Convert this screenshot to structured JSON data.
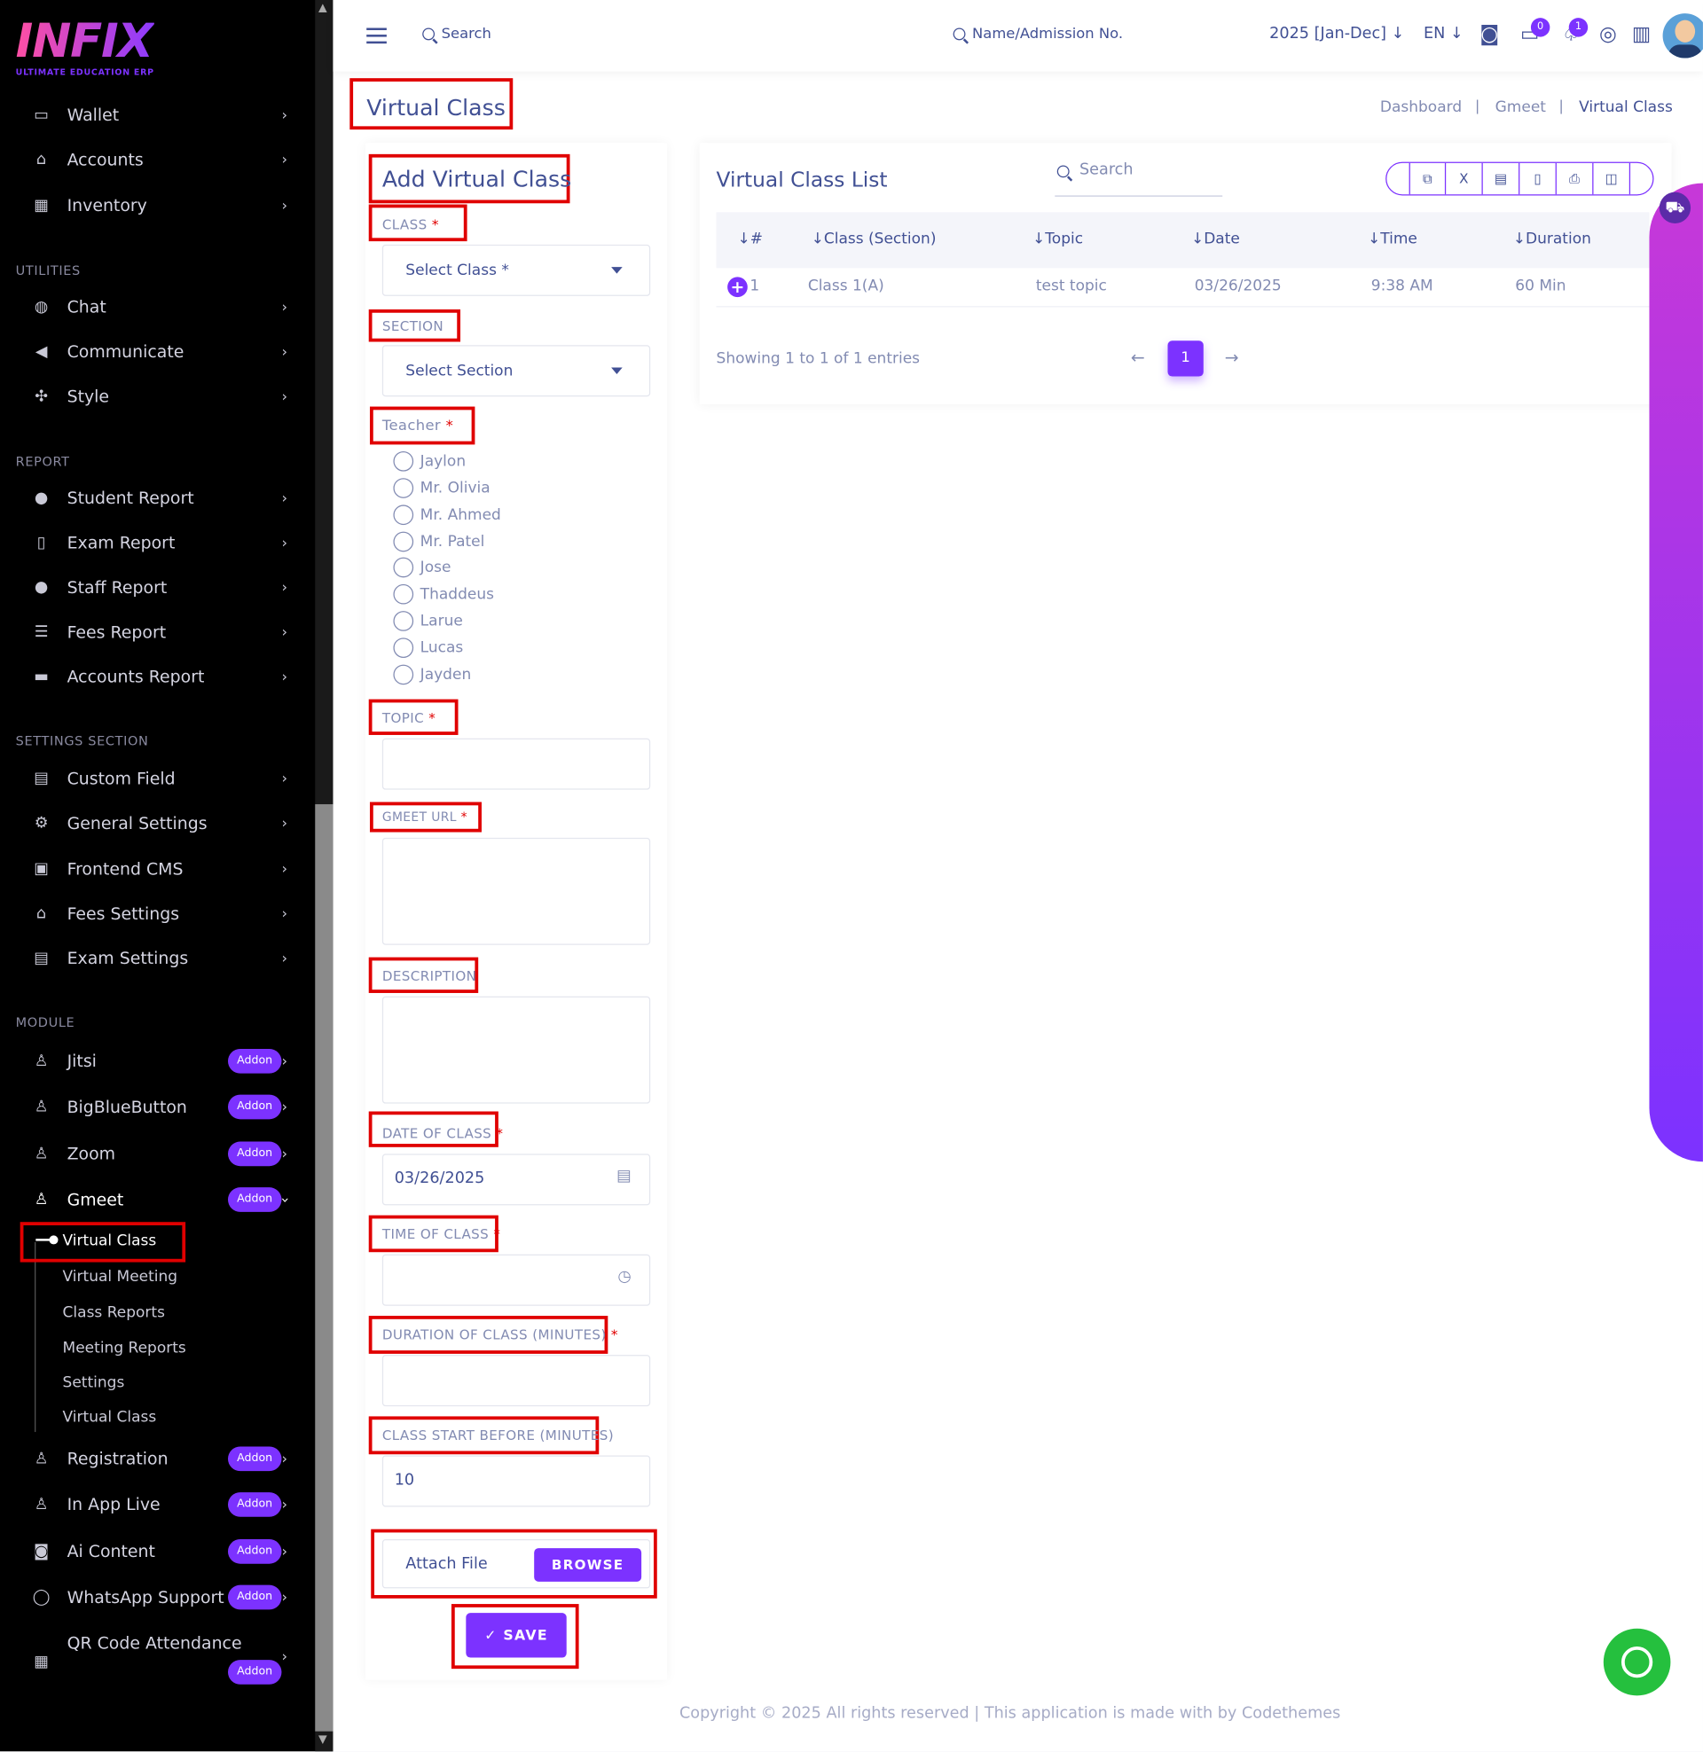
{
  "sidebar": {
    "logo": "INFIX",
    "logo_subtitle": "ULTIMATE EDUCATION ERP",
    "sections": {
      "utilities": "UTILITIES",
      "report": "REPORT",
      "settings": "SETTINGS SECTION",
      "module": "MODULE"
    },
    "items": {
      "wallet": "Wallet",
      "accounts": "Accounts",
      "inventory": "Inventory",
      "chat": "Chat",
      "communicate": "Communicate",
      "style": "Style",
      "student_report": "Student Report",
      "exam_report": "Exam Report",
      "staff_report": "Staff Report",
      "fees_report": "Fees Report",
      "accounts_report": "Accounts Report",
      "custom_field": "Custom Field",
      "general_settings": "General Settings",
      "frontend_cms": "Frontend CMS",
      "fees_settings": "Fees Settings",
      "exam_settings": "Exam Settings",
      "jitsi": "Jitsi",
      "bigbluebutton": "BigBlueButton",
      "zoom": "Zoom",
      "gmeet": "Gmeet",
      "registration": "Registration",
      "in_app_live": "In App Live",
      "ai_content": "Ai Content",
      "whatsapp_support": "WhatsApp Support",
      "qr_code_attendance": "QR Code Attendance"
    },
    "addon_label": "Addon",
    "gmeet_submenu": {
      "virtual_class": "Virtual Class",
      "virtual_meeting": "Virtual Meeting",
      "class_reports": "Class Reports",
      "meeting_reports": "Meeting Reports",
      "settings": "Settings",
      "virtual_class_2": "Virtual Class"
    }
  },
  "header": {
    "search": "Search",
    "student_search": "Name/Admission No.",
    "year": "2025 [Jan-Dec]",
    "language": "EN",
    "chat_badge": "0",
    "notification_badge": "1",
    "icons": [
      "menu-icon",
      "search-icon",
      "chevron-down-icon",
      "robot-icon",
      "chat-bubble-icon",
      "bell-icon",
      "globe-icon",
      "chart-icon",
      "avatar"
    ]
  },
  "page": {
    "title": "Virtual Class",
    "breadcrumb": [
      "Dashboard",
      "Gmeet",
      "Virtual Class"
    ]
  },
  "form": {
    "title": "Add Virtual Class",
    "class_label": "CLASS",
    "class_placeholder": "Select Class *",
    "section_label": "SECTION",
    "section_placeholder": "Select Section",
    "teacher_label": "Teacher",
    "teachers": [
      "Jaylon",
      "Mr. Olivia",
      "Mr. Ahmed",
      "Mr. Patel",
      "Jose",
      "Thaddeus",
      "Larue",
      "Lucas",
      "Jayden"
    ],
    "topic_label": "TOPIC",
    "gmeet_url_label": "GMEET URL",
    "description_label": "DESCRIPTION",
    "date_label": "DATE OF CLASS",
    "date_value": "03/26/2025",
    "time_label": "TIME OF CLASS",
    "duration_label": "DURATION OF CLASS (MINUTES)",
    "start_before_label": "CLASS START BEFORE (MINUTES)",
    "start_before_value": "10",
    "attach_file_label": "Attach File",
    "browse_label": "BROWSE",
    "save_label": "✓ SAVE",
    "required_mark": "*"
  },
  "list": {
    "title": "Virtual Class List",
    "search_placeholder": "Search",
    "export_buttons": [
      "copy-icon",
      "excel-icon",
      "csv-icon",
      "pdf-icon",
      "print-icon",
      "columns-icon"
    ],
    "columns": [
      "#",
      "Class (Section)",
      "Topic",
      "Date",
      "Time",
      "Duration"
    ],
    "rows": [
      {
        "num": "1",
        "class_section": "Class 1(A)",
        "topic": "test topic",
        "date": "03/26/2025",
        "time": "9:38 AM",
        "duration": "60 Min"
      }
    ],
    "showing": "Showing 1 to 1 of 1 entries",
    "current_page": "1"
  },
  "footer": {
    "text": "Copyright © 2025 All rights reserved | This application is made with by Codethemes"
  },
  "colors": {
    "accent": "#7c32ff",
    "text": "#415094",
    "muted": "#828bb2",
    "highlight_box": "#e00000",
    "whatsapp": "#25c03e"
  }
}
